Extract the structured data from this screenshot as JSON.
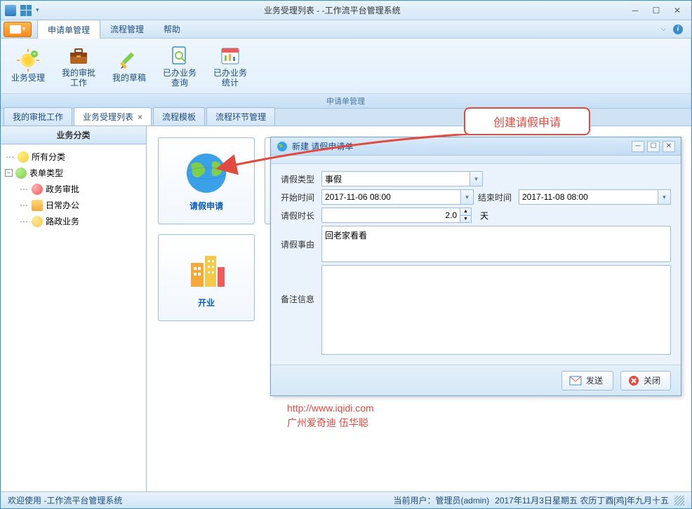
{
  "window": {
    "title": "业务受理列表 - -工作流平台管理系统"
  },
  "menu": {
    "tabs": [
      "申请单管理",
      "流程管理",
      "帮助"
    ],
    "active": 0
  },
  "ribbon": {
    "group_title": "申请单管理",
    "items": [
      {
        "label": "业务受理"
      },
      {
        "label": "我的审批工作"
      },
      {
        "label": "我的草稿"
      },
      {
        "label": "已办业务查询"
      },
      {
        "label": "已办业务统计"
      }
    ]
  },
  "doc_tabs": {
    "items": [
      {
        "label": "我的审批工作",
        "closable": false,
        "active": false
      },
      {
        "label": "业务受理列表",
        "closable": true,
        "active": true
      },
      {
        "label": "流程模板",
        "closable": false,
        "active": false
      },
      {
        "label": "流程环节管理",
        "closable": false,
        "active": false
      }
    ]
  },
  "tree": {
    "header": "业务分类",
    "root": [
      {
        "label": "所有分类",
        "icon": "#f7c948"
      },
      {
        "label": "表单类型",
        "icon": "#7fce4c",
        "expanded": true,
        "children": [
          {
            "label": "政务审批",
            "icon": "#f05a5a"
          },
          {
            "label": "日常办公",
            "icon": "#f4a93a"
          },
          {
            "label": "路政业务",
            "icon": "#f7c948"
          }
        ]
      }
    ]
  },
  "cards": [
    {
      "label": "请假申请",
      "kind": "globe"
    },
    {
      "label": "开业",
      "kind": "buildings"
    }
  ],
  "callout": {
    "text": "创建请假申请"
  },
  "dialog": {
    "title": "新建 请假申请单",
    "fields": {
      "type_label": "请假类型",
      "type_value": "事假",
      "start_label": "开始时间",
      "start_value": "2017-11-06 08:00",
      "end_label": "结束时间",
      "end_value": "2017-11-08 08:00",
      "duration_label": "请假时长",
      "duration_value": "2.0",
      "duration_unit": "天",
      "reason_label": "请假事由",
      "reason_value": "回老家看看",
      "remark_label": "备注信息",
      "remark_value": ""
    },
    "buttons": {
      "send": "发送",
      "close": "关闭"
    }
  },
  "watermark": {
    "url": "http://www.iqidi.com",
    "org": "广州爱奇迪 伍华聪"
  },
  "status": {
    "left": "欢迎使用 -工作流平台管理系统",
    "user": "当前用户：管理员(admin)",
    "date": "2017年11月3日星期五 农历丁酉[鸡]年九月十五"
  }
}
